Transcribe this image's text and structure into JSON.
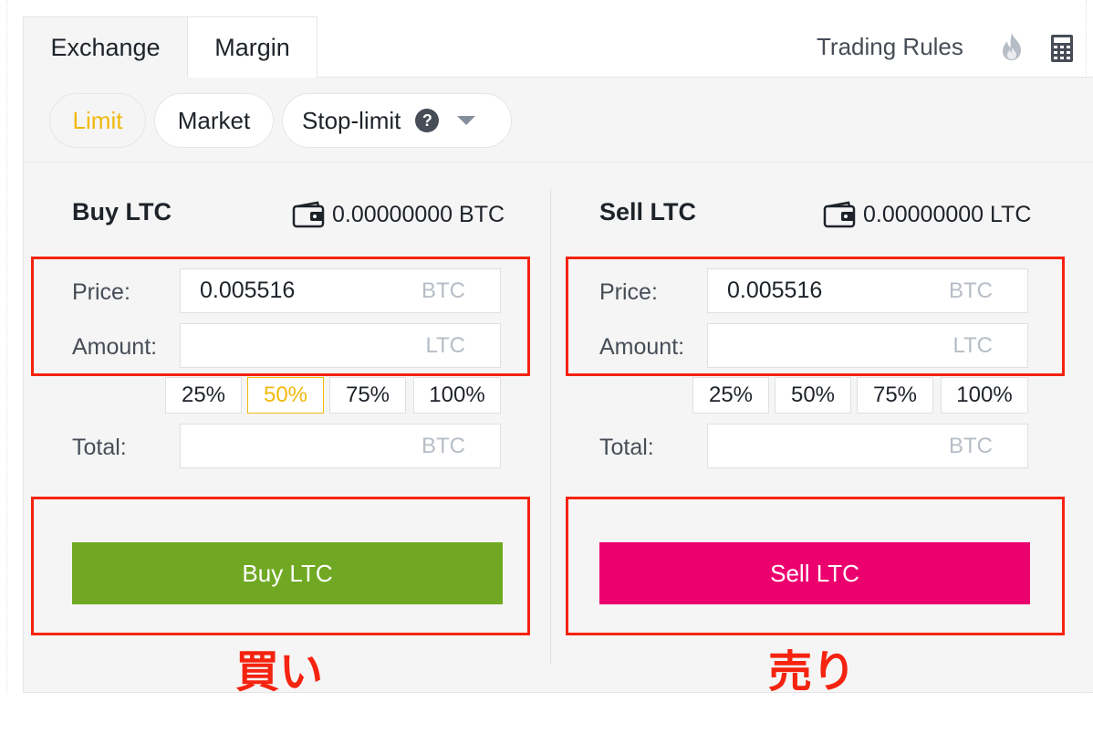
{
  "tabs": {
    "exchange": "Exchange",
    "margin": "Margin"
  },
  "toolbar": {
    "trading_rules": "Trading Rules",
    "fire_icon": "fire-icon",
    "calculator_icon": "calculator-icon"
  },
  "order_types": {
    "limit": "Limit",
    "market": "Market",
    "stop_limit": "Stop-limit",
    "help": "?",
    "selected": "Limit"
  },
  "buy": {
    "title": "Buy LTC",
    "balance": "0.00000000 BTC",
    "price_label": "Price:",
    "price_value": "0.005516",
    "price_unit": "BTC",
    "amount_label": "Amount:",
    "amount_unit": "LTC",
    "percentages": [
      "25%",
      "50%",
      "75%",
      "100%"
    ],
    "selected_percentage": "50%",
    "total_label": "Total:",
    "total_unit": "BTC",
    "button": "Buy LTC",
    "annotation": "買い"
  },
  "sell": {
    "title": "Sell LTC",
    "balance": "0.00000000 LTC",
    "price_label": "Price:",
    "price_value": "0.005516",
    "price_unit": "BTC",
    "amount_label": "Amount:",
    "amount_unit": "LTC",
    "percentages": [
      "25%",
      "50%",
      "75%",
      "100%"
    ],
    "total_label": "Total:",
    "total_unit": "BTC",
    "button": "Sell LTC",
    "annotation": "売り"
  },
  "colors": {
    "accent": "#f0b90b",
    "buy": "#70a823",
    "sell": "#ec006e",
    "highlight": "#f5230f"
  }
}
